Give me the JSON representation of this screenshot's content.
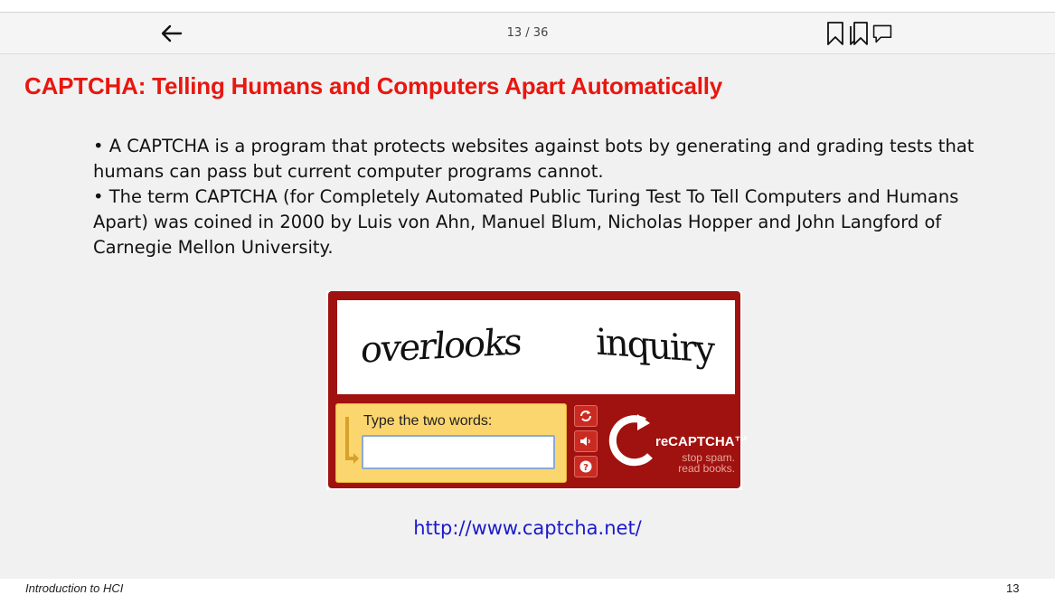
{
  "toolbar": {
    "page_indicator": "13 / 36",
    "back_icon": "arrow-left-icon",
    "icons": [
      "bookmark-icon",
      "bookmarks-icon",
      "comment-icon"
    ]
  },
  "slide": {
    "title": "CAPTCHA: Telling Humans and Computers Apart Automatically",
    "bullets": [
      "• A CAPTCHA is a program that protects websites against bots by generating and grading tests that humans can pass but current computer programs cannot.",
      "• The term CAPTCHA (for Completely Automated Public Turing Test To Tell Computers and Humans Apart) was coined in 2000 by Luis von Ahn, Manuel Blum, Nicholas Hopper and John Langford of Carnegie Mellon University."
    ],
    "captcha": {
      "word1": "overlooks",
      "word2": "inquiry",
      "prompt": "Type the two words:",
      "input_value": "",
      "brand": "reCAPTCHA™",
      "tagline_line1": "stop spam.",
      "tagline_line2": "read books."
    },
    "link": "http://www.captcha.net/"
  },
  "footer": {
    "course": "Introduction to HCI",
    "page_number": "13"
  },
  "colors": {
    "title_red": "#e8170f",
    "captcha_red": "#a0120f",
    "answer_yellow": "#fbd56d",
    "link_blue": "#1a1acc"
  }
}
